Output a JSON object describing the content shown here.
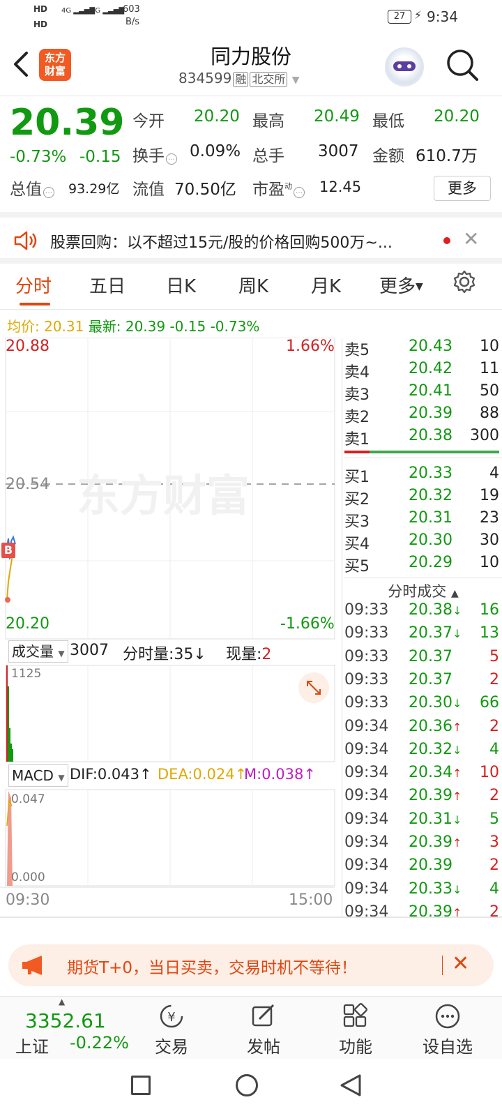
{
  "status": {
    "hd1": "HD",
    "hd2": "HD",
    "sig1": "4G",
    "sig2": "4G",
    "speed_top": "603",
    "speed_bot": "B/s",
    "battery": "27",
    "time": "9:34"
  },
  "header": {
    "logo_top": "东方",
    "logo_bot": "财富",
    "title": "同力股份",
    "code": "834599",
    "tag1": "融",
    "tag2": "北交所"
  },
  "quote": {
    "price": "20.39",
    "pct": "-0.73%",
    "chg": "-0.15",
    "open_l": "今开",
    "open_v": "20.20",
    "high_l": "最高",
    "high_v": "20.49",
    "low_l": "最低",
    "low_v": "20.20",
    "turn_l": "换手",
    "turn_v": "0.09%",
    "vol_l": "总手",
    "vol_v": "3007",
    "amt_l": "金额",
    "amt_v": "610.7万",
    "mcap_l": "总值",
    "mcap_v": "93.29亿",
    "float_l": "流值",
    "float_v": "70.50亿",
    "pe_l": "市盈",
    "pe_sup": "动",
    "pe_v": "12.45",
    "more": "更多"
  },
  "notice": {
    "text": "股票回购：以不超过15元/股的价格回购500万~..."
  },
  "tabs": [
    "分时",
    "五日",
    "日K",
    "周K",
    "月K",
    "更多"
  ],
  "avg": {
    "avg_l": "均价:",
    "avg_v": "20.31",
    "new_l": "最新:",
    "new_v": "20.39",
    "chg": "-0.15",
    "pct": "-0.73%"
  },
  "chart": {
    "top_price": "20.88",
    "top_pct": "1.66%",
    "mid_price": "20.54",
    "bot_price": "20.20",
    "bot_pct": "-1.66%",
    "watermark": "东方财富",
    "b_marker": "B",
    "vol_sel": "成交量",
    "vol_total": "3007",
    "fs_l": "分时量:",
    "fs_v": "35",
    "fs_arrow": "↓",
    "now_l": "现量:",
    "now_v": "2",
    "vol_max": "1125",
    "macd_sel": "MACD",
    "dif": "DIF:0.043",
    "dea": "DEA:0.024",
    "m": "M:0.038",
    "up": "↑",
    "macd_max": "0.047",
    "macd_min": "0.000",
    "t_start": "09:30",
    "t_end": "15:00"
  },
  "book": {
    "sell": [
      {
        "k": "卖5",
        "p": "20.43",
        "q": "10"
      },
      {
        "k": "卖4",
        "p": "20.42",
        "q": "11"
      },
      {
        "k": "卖3",
        "p": "20.41",
        "q": "50"
      },
      {
        "k": "卖2",
        "p": "20.39",
        "q": "88"
      },
      {
        "k": "卖1",
        "p": "20.38",
        "q": "300"
      }
    ],
    "buy": [
      {
        "k": "买1",
        "p": "20.33",
        "q": "4"
      },
      {
        "k": "买2",
        "p": "20.32",
        "q": "19"
      },
      {
        "k": "买3",
        "p": "20.31",
        "q": "23"
      },
      {
        "k": "买4",
        "p": "20.30",
        "q": "30"
      },
      {
        "k": "买5",
        "p": "20.29",
        "q": "10"
      }
    ],
    "ticks_title": "分时成交",
    "ticks": [
      {
        "t": "09:33",
        "p": "20.38",
        "a": "↓",
        "v": "16",
        "c": "g"
      },
      {
        "t": "09:33",
        "p": "20.37",
        "a": "↓",
        "v": "13",
        "c": "g"
      },
      {
        "t": "09:33",
        "p": "20.37",
        "a": "",
        "v": "5",
        "c": "r"
      },
      {
        "t": "09:33",
        "p": "20.37",
        "a": "",
        "v": "2",
        "c": "r"
      },
      {
        "t": "09:33",
        "p": "20.30",
        "a": "↓",
        "v": "66",
        "c": "g"
      },
      {
        "t": "09:34",
        "p": "20.36",
        "a": "↑",
        "v": "2",
        "c": "r"
      },
      {
        "t": "09:34",
        "p": "20.32",
        "a": "↓",
        "v": "4",
        "c": "g"
      },
      {
        "t": "09:34",
        "p": "20.34",
        "a": "↑",
        "v": "10",
        "c": "r"
      },
      {
        "t": "09:34",
        "p": "20.39",
        "a": "↑",
        "v": "2",
        "c": "r"
      },
      {
        "t": "09:34",
        "p": "20.31",
        "a": "↓",
        "v": "5",
        "c": "g"
      },
      {
        "t": "09:34",
        "p": "20.39",
        "a": "↑",
        "v": "3",
        "c": "r"
      },
      {
        "t": "09:34",
        "p": "20.39",
        "a": "",
        "v": "2",
        "c": "r"
      },
      {
        "t": "09:34",
        "p": "20.33",
        "a": "↓",
        "v": "4",
        "c": "g"
      },
      {
        "t": "09:34",
        "p": "20.39",
        "a": "↑",
        "v": "2",
        "c": "r"
      }
    ]
  },
  "banner": {
    "text": "期货T+0，当日买卖，交易时机不等待！"
  },
  "bottom": {
    "index_v": "3352.61",
    "index_name": "上证",
    "index_pct": "-0.22%",
    "trade": "交易",
    "post": "发帖",
    "func": "功能",
    "watch": "设自选"
  },
  "colors": {
    "up": "#d22222",
    "down": "#119911",
    "accent": "#e0470f",
    "avg": "#e0a800"
  }
}
